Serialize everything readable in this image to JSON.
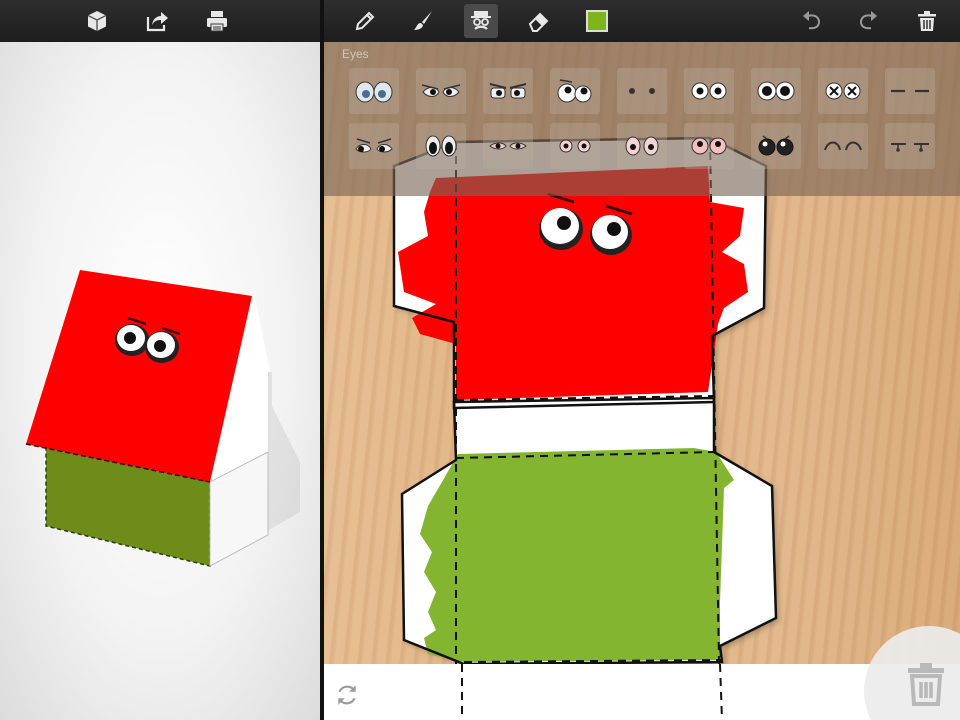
{
  "toolbar_left": {
    "icons": [
      "cube-icon",
      "share-icon",
      "print-icon"
    ]
  },
  "toolbar_right": {
    "tools": [
      "pencil-icon",
      "brush-icon",
      "face-stamp-icon",
      "eraser-icon"
    ],
    "active_tool": "face-stamp-icon",
    "current_color": "#7db51a",
    "actions": [
      "undo-icon",
      "redo-icon",
      "trash-icon"
    ]
  },
  "eyes_panel": {
    "title": "Eyes",
    "rows": [
      [
        "eyes-blue-worried",
        "eyes-angry-narrow",
        "eyes-angry-squint",
        "eyes-googly-up",
        "eyes-dots-small",
        "eyes-round-open",
        "eyes-round-big",
        "eyes-x-dead",
        "eyes-dash-closed"
      ],
      [
        "eyes-side-glance",
        "eyes-oval-dark",
        "eyes-red-slit",
        "eyes-red-small",
        "eyes-red-oval",
        "eyes-pink-round",
        "eyes-black-shiny",
        "eyes-arch-happy",
        "eyes-sleepy-lashes"
      ]
    ]
  },
  "colors": {
    "roof_red": "#ff0000",
    "wall_green": "#84b531",
    "toolbar_bg": "#242424"
  }
}
